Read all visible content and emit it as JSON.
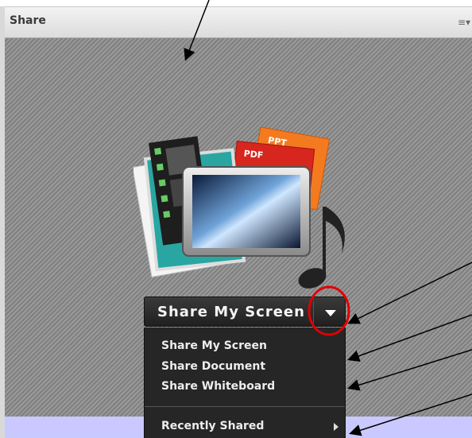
{
  "pod": {
    "title": "Share",
    "menu_icon": "options-menu-icon"
  },
  "share_button": {
    "label": "Share My Screen",
    "arrow_icon": "chevron-down-icon"
  },
  "share_menu": {
    "items": [
      {
        "label": "Share My Screen"
      },
      {
        "label": "Share Document"
      },
      {
        "label": "Share Whiteboard"
      }
    ],
    "recent": {
      "label": "Recently Shared",
      "arrow_icon": "submenu-arrow-icon"
    }
  },
  "graphic": {
    "ppt_label": "PPT",
    "pdf_label": "PDF"
  },
  "colors": {
    "annotation_arrow": "#000000",
    "highlight_circle": "#e00000",
    "footer_strip": "#c9c9ff"
  }
}
